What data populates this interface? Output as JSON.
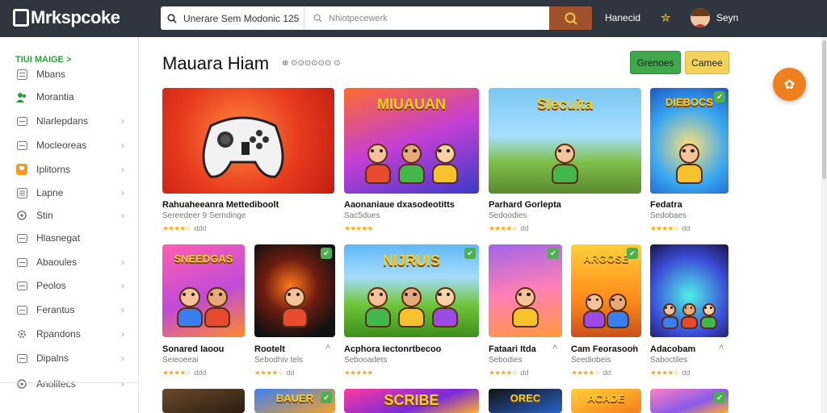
{
  "header": {
    "logo": "Mrkspcoke",
    "search_category": "Unerare Sem Modonic 125",
    "search_placeholder": "Nhiotpecewerk",
    "link": "Hanecid",
    "user": "Seyn",
    "accent": "#a0522d"
  },
  "sidebar": {
    "heading": "TIUI MAIGE >",
    "items": [
      {
        "label": "Mbans",
        "icon": "grid-icon",
        "chevron": false
      },
      {
        "label": "Morantia",
        "icon": "people-icon",
        "chevron": false
      },
      {
        "label": "Nlarlepdans",
        "icon": "box-icon",
        "chevron": true
      },
      {
        "label": "Mocleoreas",
        "icon": "box-icon",
        "chevron": true
      },
      {
        "label": "Iplitorns",
        "icon": "trophy-icon",
        "chevron": true
      },
      {
        "label": "Lapne",
        "icon": "list-icon",
        "chevron": true
      },
      {
        "label": "Stin",
        "icon": "settings-icon",
        "chevron": true
      },
      {
        "label": "Hlasnegat",
        "icon": "box-icon",
        "chevron": false
      },
      {
        "label": "Abaoules",
        "icon": "box-icon",
        "chevron": true
      },
      {
        "label": "Peolos",
        "icon": "box-icon",
        "chevron": true
      },
      {
        "label": "Ferantus",
        "icon": "box-icon",
        "chevron": true
      },
      {
        "label": "Rpandons",
        "icon": "gear-icon",
        "chevron": true
      },
      {
        "label": "Dipalns",
        "icon": "box-icon",
        "chevron": true
      },
      {
        "label": "Anolitecs",
        "icon": "settings-icon",
        "chevron": true
      }
    ]
  },
  "main": {
    "title": "Mauara Hiam",
    "title_meta": "⊕ ⊙⊙⊙⊙⊙⊙ ⊙",
    "btn_primary": "Grenoes",
    "btn_secondary": "Camee",
    "row1": [
      {
        "title": "Rahuaheeanra Mettediboolt",
        "sub": "Sereedeer 9 Serndinge",
        "rating": 4,
        "count": "ddd",
        "label": ""
      },
      {
        "title": "Aaonaniaue dxasodeotitts",
        "sub": "Sac5dues",
        "rating": 5,
        "count": "",
        "label": "MIUAUAN"
      },
      {
        "title": "Parhard Gorlepta",
        "sub": "Sedoodies",
        "rating": 4,
        "count": "dd",
        "label": "Slecuita"
      },
      {
        "title": "Fedatra",
        "sub": "Sedobaes",
        "rating": 4,
        "count": "dd",
        "label": "DIEBOCS"
      }
    ],
    "row2": [
      {
        "title": "Sonared Iaoou",
        "sub": "Seieoeeai",
        "rating": 4,
        "count": "ddd",
        "label": "SNEEDGAS"
      },
      {
        "title": "Rootelt",
        "sub": "Sebodhiv tels",
        "rating": 4,
        "count": "dd",
        "label": ""
      },
      {
        "title": "Acphora Iectonrtbecoo",
        "sub": "Sebooadets",
        "rating": 5,
        "count": "",
        "label": "NIJRUIS"
      },
      {
        "title": "Fataari Itda",
        "sub": "Sebodies",
        "rating": 4,
        "count": "dd",
        "label": ""
      },
      {
        "title": "Cam Feorasoon",
        "sub": "Seediobeis",
        "rating": 4,
        "count": "dd",
        "label": "ARGOSE"
      },
      {
        "title": "Adacobam",
        "sub": "Saboctiles",
        "rating": 4,
        "count": "dd",
        "label": ""
      }
    ],
    "row3": [
      {
        "label": ""
      },
      {
        "label": "BAUER"
      },
      {
        "label": "SCRIBE"
      },
      {
        "label": "OREC"
      },
      {
        "label": "ACADE"
      },
      {
        "label": ""
      }
    ]
  }
}
